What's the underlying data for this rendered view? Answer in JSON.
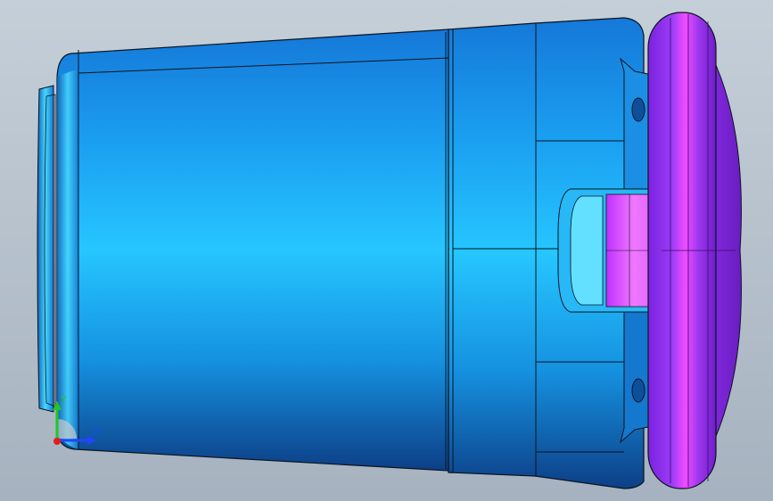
{
  "viewport": {
    "background_top": "#c5cfd8",
    "background_bottom": "#a6b2bf"
  },
  "model": {
    "body_color": "#1fa9ef",
    "body_shadow_color": "#0d3f86",
    "body_highlight_color": "#3fd3ff",
    "flange_color": "#8a2cf2",
    "flange_highlight_color": "#ee42ff",
    "edge_color": "#0a1420"
  },
  "triad": {
    "y_label": "Y",
    "z_label": "Z",
    "y_color": "#22c622",
    "z_color": "#2244ff",
    "x_color": "#e01f1f"
  }
}
